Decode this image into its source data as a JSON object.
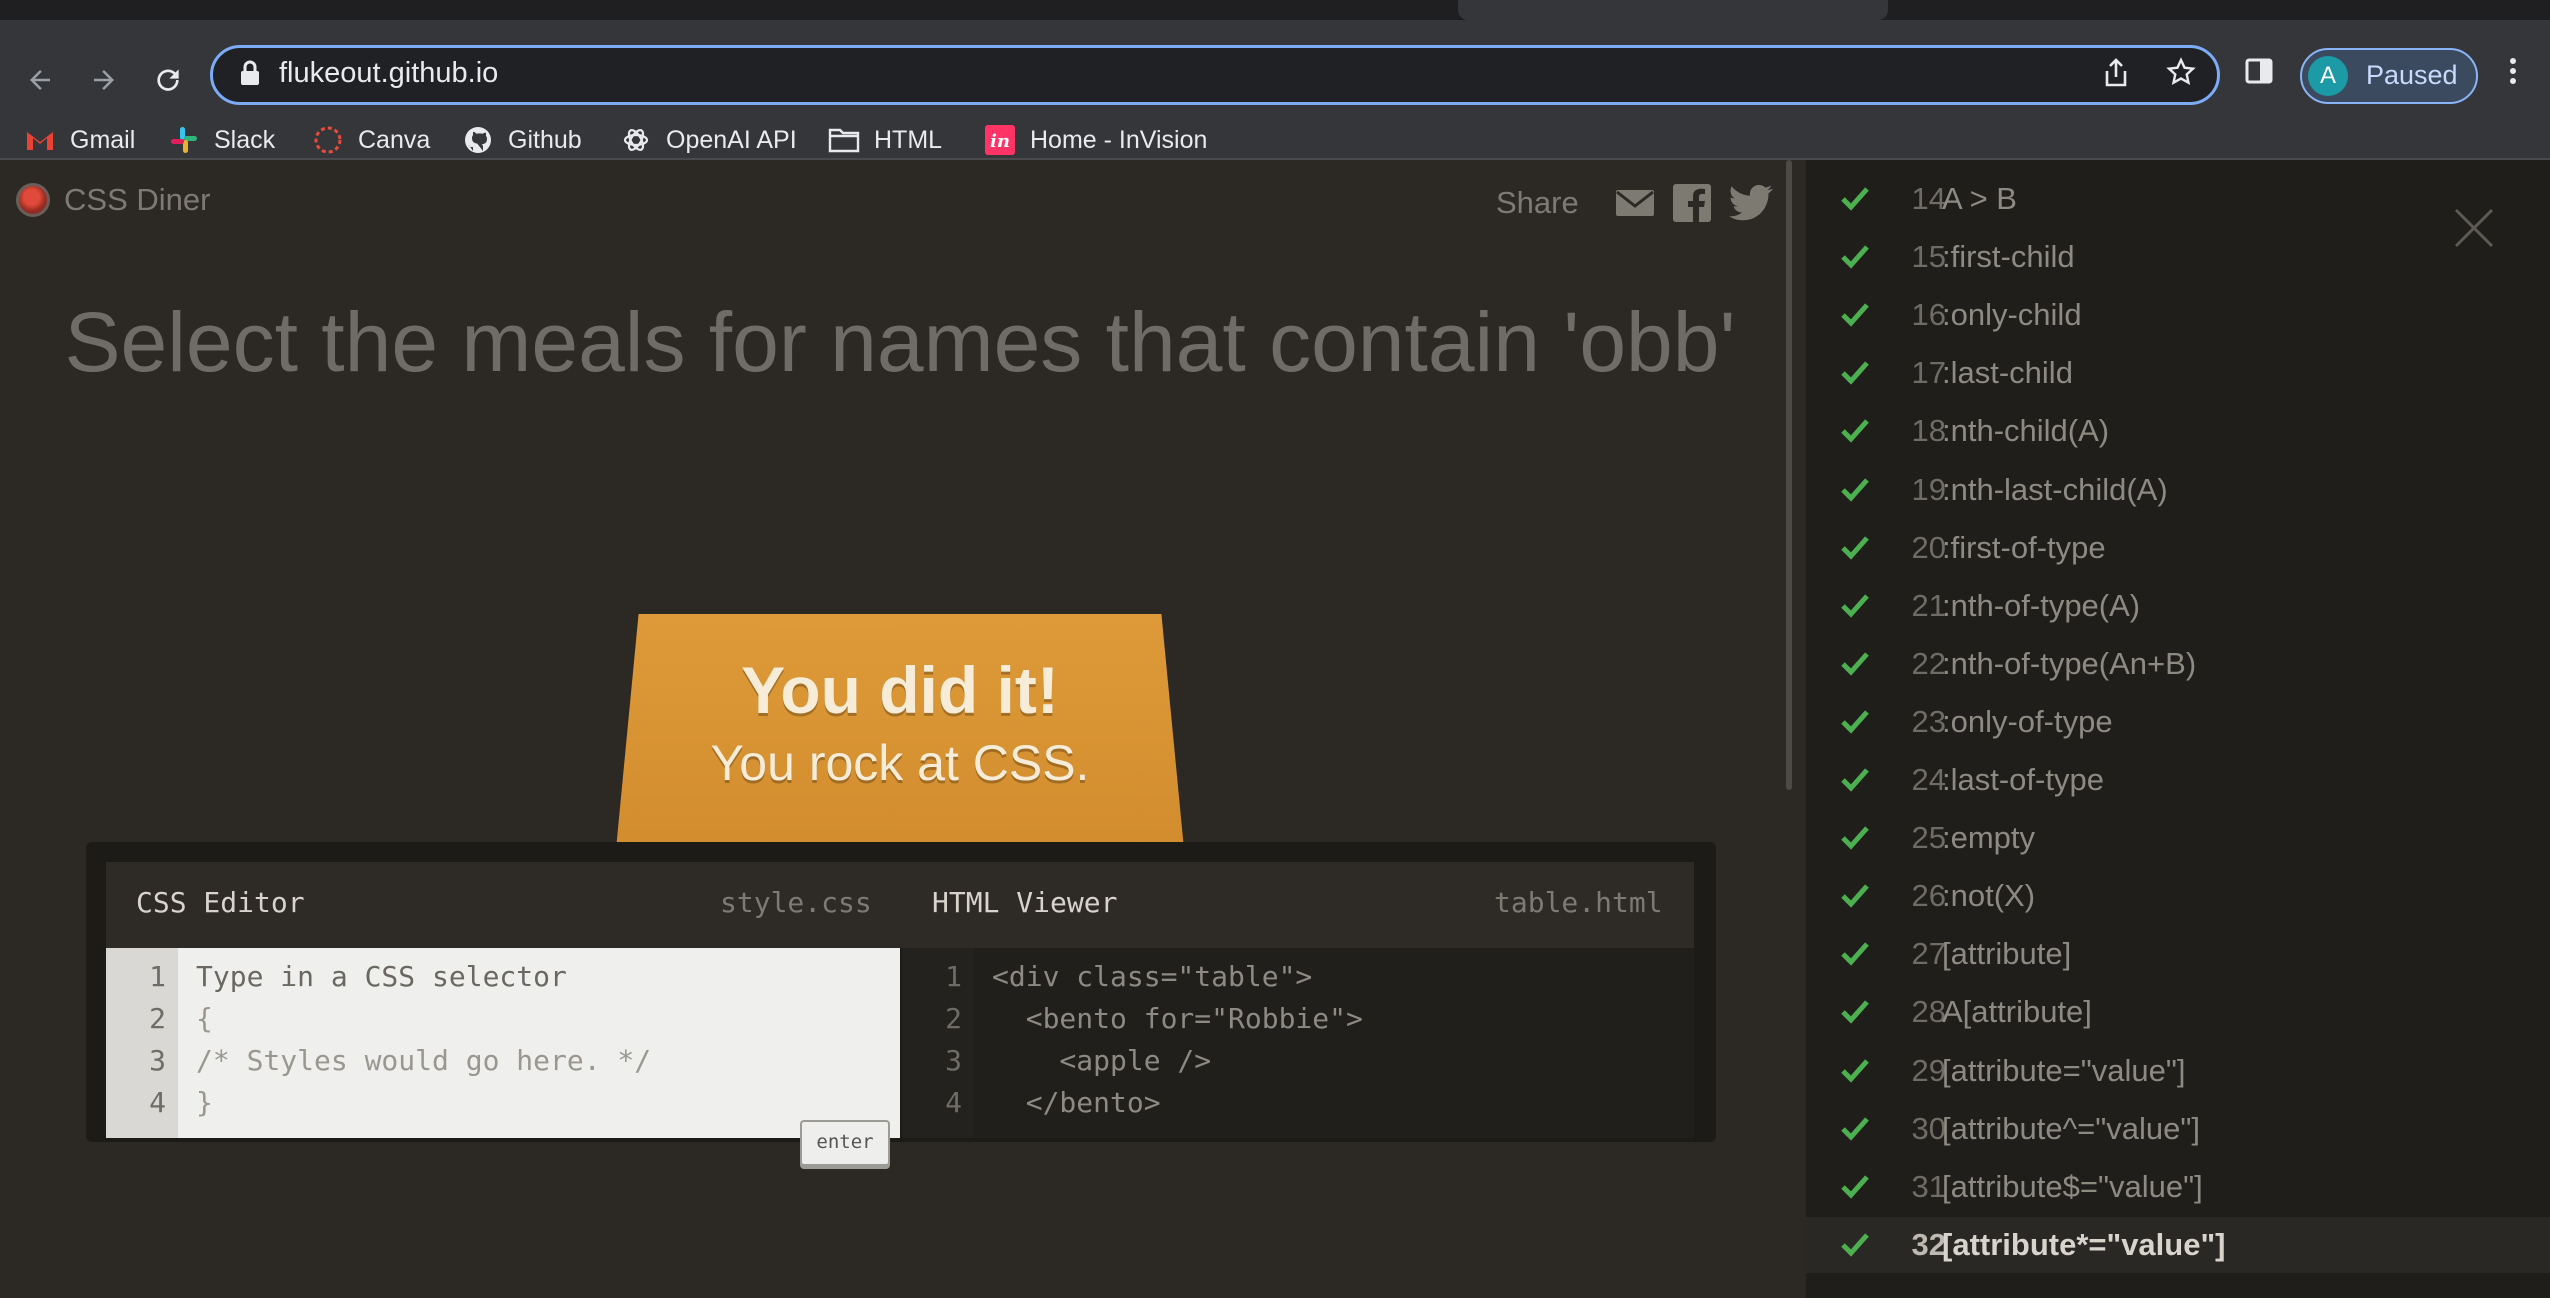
{
  "browser": {
    "url": "flukeout.github.io",
    "profile": {
      "initial": "A",
      "label": "Paused"
    },
    "bookmarks": [
      "Gmail",
      "Slack",
      "Canva",
      "Github",
      "OpenAI API",
      "HTML",
      "Home - InVision"
    ]
  },
  "game": {
    "logo": "CSS Diner",
    "share_label": "Share",
    "order": "Select the meals for names that contain 'obb'",
    "win_line1": "You did it!",
    "win_line2": "You rock at CSS.",
    "css_editor": {
      "title": "CSS Editor",
      "file": "style.css",
      "enter_label": "enter",
      "line_numbers": [
        "1",
        "2",
        "3",
        "4"
      ],
      "lines": [
        "Type in a CSS selector",
        "{",
        "/* Styles would go here. */",
        "}"
      ]
    },
    "html_viewer": {
      "title": "HTML Viewer",
      "file": "table.html",
      "line_numbers": [
        "1",
        "2",
        "3",
        "4"
      ],
      "lines": [
        "<div class=\"table\">",
        "  <bento for=\"Robbie\">",
        "    <apple />",
        "  </bento>"
      ]
    }
  },
  "levels": [
    {
      "num": "14",
      "selector": "A > B"
    },
    {
      "num": "15",
      "selector": ":first-child"
    },
    {
      "num": "16",
      "selector": ":only-child"
    },
    {
      "num": "17",
      "selector": ":last-child"
    },
    {
      "num": "18",
      "selector": ":nth-child(A)"
    },
    {
      "num": "19",
      "selector": ":nth-last-child(A)"
    },
    {
      "num": "20",
      "selector": ":first-of-type"
    },
    {
      "num": "21",
      "selector": ":nth-of-type(A)"
    },
    {
      "num": "22",
      "selector": ":nth-of-type(An+B)"
    },
    {
      "num": "23",
      "selector": ":only-of-type"
    },
    {
      "num": "24",
      "selector": ":last-of-type"
    },
    {
      "num": "25",
      "selector": ":empty"
    },
    {
      "num": "26",
      "selector": ":not(X)"
    },
    {
      "num": "27",
      "selector": "[attribute]"
    },
    {
      "num": "28",
      "selector": "A[attribute]"
    },
    {
      "num": "29",
      "selector": "[attribute=\"value\"]"
    },
    {
      "num": "30",
      "selector": "[attribute^=\"value\"]"
    },
    {
      "num": "31",
      "selector": "[attribute$=\"value\"]"
    },
    {
      "num": "32",
      "selector": "[attribute*=\"value\"]"
    }
  ],
  "colors": {
    "check": "#4caf50",
    "table": "#d99333",
    "omnibox_focus": "#7cacf8"
  }
}
